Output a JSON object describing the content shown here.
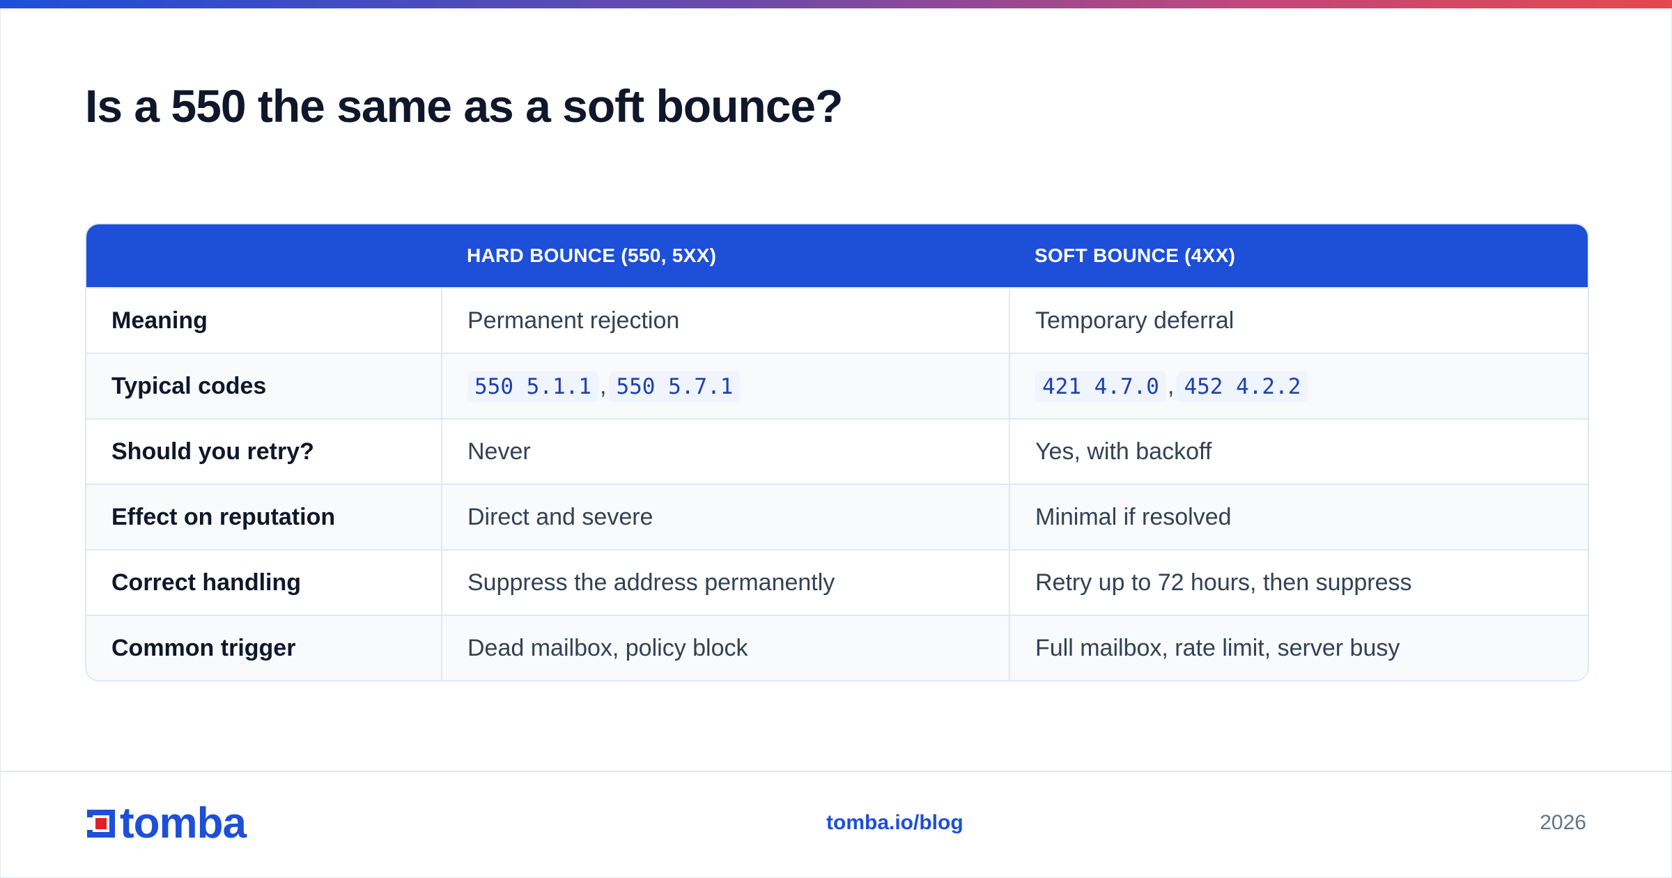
{
  "title": "Is a 550 the same as a soft bounce?",
  "table": {
    "headers": [
      "",
      "HARD BOUNCE (550, 5XX)",
      "SOFT BOUNCE (4XX)"
    ],
    "rows": [
      {
        "label": "Meaning",
        "hard": "Permanent rejection",
        "soft": "Temporary deferral"
      },
      {
        "label": "Typical codes",
        "hard_codes": [
          "550 5.1.1",
          "550 5.7.1"
        ],
        "soft_codes": [
          "421 4.7.0",
          "452 4.2.2"
        ],
        "separator": ","
      },
      {
        "label": "Should you retry?",
        "hard": "Never",
        "soft": "Yes, with backoff"
      },
      {
        "label": "Effect on reputation",
        "hard": "Direct and severe",
        "soft": "Minimal if resolved"
      },
      {
        "label": "Correct handling",
        "hard": "Suppress the address permanently",
        "soft": "Retry up to 72 hours, then suppress"
      },
      {
        "label": "Common trigger",
        "hard": "Dead mailbox, policy block",
        "soft": "Full mailbox, rate limit, server busy"
      }
    ]
  },
  "footer": {
    "logo_text": "tomba",
    "logo_icon": "tomba-logo-mark-icon",
    "link": "tomba.io/blog",
    "year": "2026"
  },
  "colors": {
    "accent": "#1d4fd8",
    "logo_red": "#e11d2a",
    "gradient": [
      "#1d4ed8",
      "#6d4aa8",
      "#c2477a",
      "#e5484d"
    ]
  }
}
